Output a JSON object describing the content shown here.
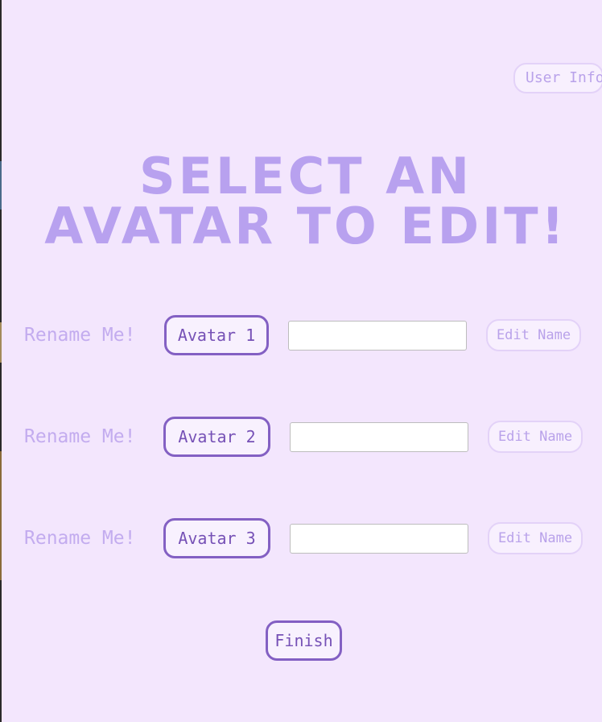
{
  "header": {
    "user_info_label": "User Info"
  },
  "title": {
    "line1": "SELECT AN",
    "line2": "AVATAR TO EDIT!"
  },
  "avatars": [
    {
      "rename_label": "Rename Me!",
      "button_label": "Avatar 1",
      "input_value": "",
      "edit_label": "Edit Name"
    },
    {
      "rename_label": "Rename Me!",
      "button_label": "Avatar 2",
      "input_value": "",
      "edit_label": "Edit Name"
    },
    {
      "rename_label": "Rename Me!",
      "button_label": "Avatar 3",
      "input_value": "",
      "edit_label": "Edit Name"
    }
  ],
  "footer": {
    "finish_label": "Finish"
  },
  "colors": {
    "background": "#f3e6fd",
    "title": "#b8a1ef",
    "accent_border": "#8360c3",
    "muted_text": "#c3acef"
  }
}
